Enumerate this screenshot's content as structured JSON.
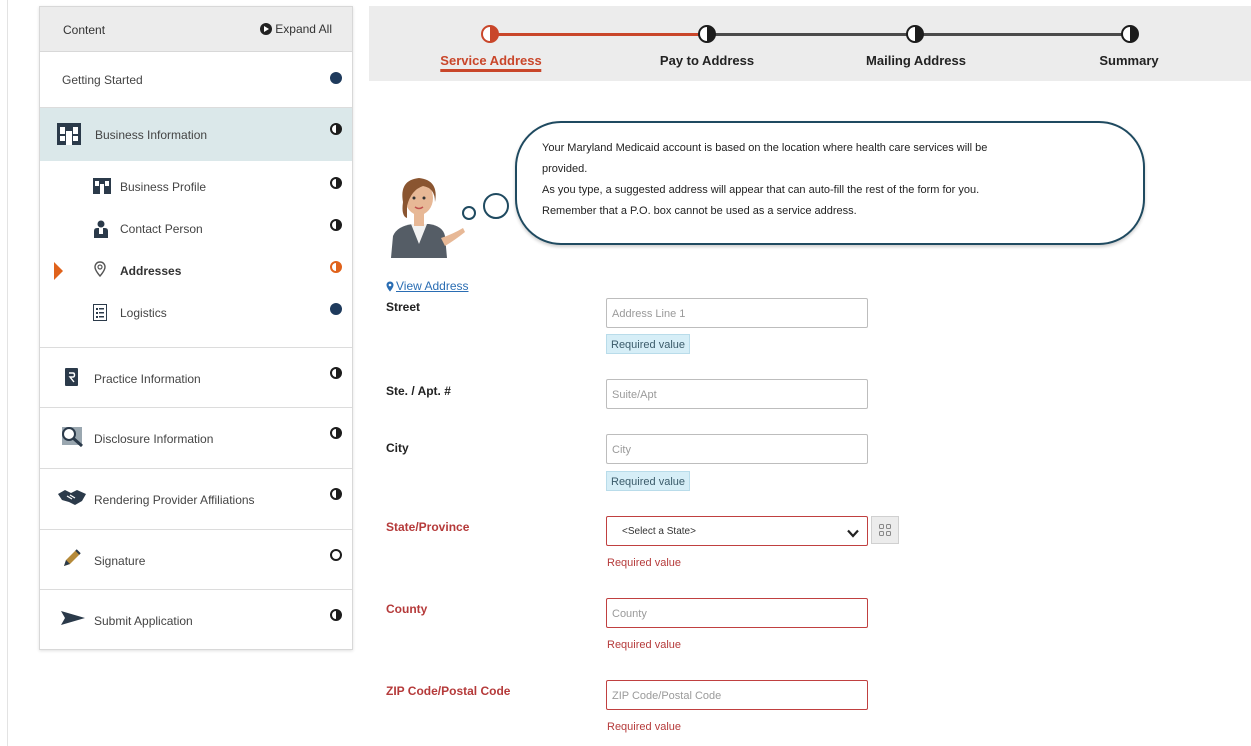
{
  "sidebar": {
    "header_title": "Content",
    "expand_all": "Expand All",
    "sections": [
      {
        "label": "Getting Started",
        "status": "complete"
      },
      {
        "label": "Business Information",
        "status": "partial"
      },
      {
        "label": "Practice Information",
        "status": "partial"
      },
      {
        "label": "Disclosure Information",
        "status": "partial"
      },
      {
        "label": "Rendering Provider Affiliations",
        "status": "partial"
      },
      {
        "label": "Signature",
        "status": "not-started"
      },
      {
        "label": "Submit Application",
        "status": "partial"
      }
    ],
    "business_subitems": [
      {
        "label": "Business Profile",
        "status": "partial"
      },
      {
        "label": "Contact Person",
        "status": "partial"
      },
      {
        "label": "Addresses",
        "status": "in-progress-current"
      },
      {
        "label": "Logistics",
        "status": "complete"
      }
    ]
  },
  "stepper": {
    "steps": [
      {
        "label": "Service Address",
        "active": true
      },
      {
        "label": "Pay to Address",
        "active": false
      },
      {
        "label": "Mailing Address",
        "active": false
      },
      {
        "label": "Summary",
        "active": false
      }
    ],
    "accent_color": "#c9462a"
  },
  "bubble": {
    "line1": "Your Maryland Medicaid account is based on the location where health care services will be",
    "line2": "provided.",
    "line3": "As you type, a suggested address will appear that can auto-fill the rest of the form for you.",
    "line4": "Remember that a P.O. box cannot be used as a service address."
  },
  "form": {
    "view_address": "View Address",
    "street_label": "Street",
    "street_placeholder": "Address Line 1",
    "suite_label": "Ste. / Apt. #",
    "suite_placeholder": "Suite/Apt",
    "city_label": "City",
    "city_placeholder": "City",
    "state_label": "State/Province",
    "state_selected": "<Select a State>",
    "county_label": "County",
    "county_placeholder": "County",
    "zip_label": "ZIP Code/Postal Code",
    "zip_placeholder": "ZIP Code/Postal Code",
    "required_text": "Required value"
  }
}
